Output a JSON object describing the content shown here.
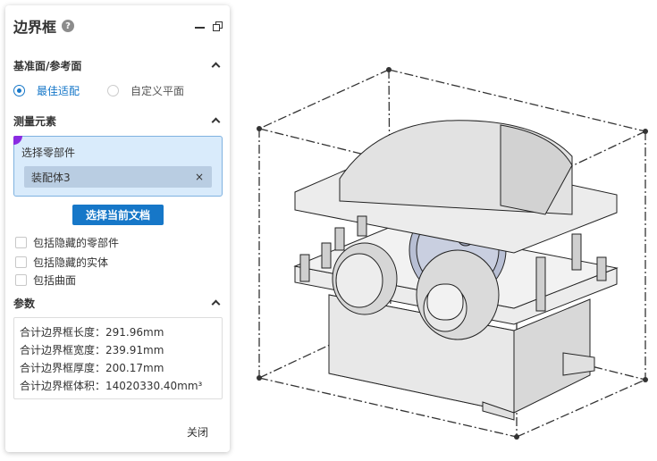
{
  "panel": {
    "title": "边界框",
    "help_glyph": "?",
    "sections": {
      "reference": {
        "label": "基准面/参考面"
      },
      "measure": {
        "label": "测量元素"
      },
      "params": {
        "label": "参数"
      }
    },
    "radios": [
      {
        "label": "最佳适配",
        "selected": true
      },
      {
        "label": "自定义平面",
        "selected": false
      }
    ],
    "selection": {
      "label": "选择零部件",
      "chip": "装配体3",
      "chip_remove": "×"
    },
    "select_current_button": "选择当前文档",
    "checkboxes": [
      {
        "label": "包括隐藏的零部件",
        "checked": false
      },
      {
        "label": "包括隐藏的实体",
        "checked": false
      },
      {
        "label": "包括曲面",
        "checked": false
      }
    ],
    "params": [
      {
        "label": "合计边界框长度：",
        "value": "291.96mm"
      },
      {
        "label": "合计边界框宽度：",
        "value": "239.91mm"
      },
      {
        "label": "合计边界框厚度：",
        "value": "200.17mm"
      },
      {
        "label": "合计边界框体积：",
        "value": "14020330.40mm³"
      }
    ],
    "close_label": "关闭"
  },
  "colors": {
    "accent": "#1677c8",
    "selection_bg": "#d9ebfb",
    "chip_bg": "#b9cde2",
    "marker": "#8a2be2"
  },
  "viewport": {
    "model": "gearbox-assembly"
  }
}
